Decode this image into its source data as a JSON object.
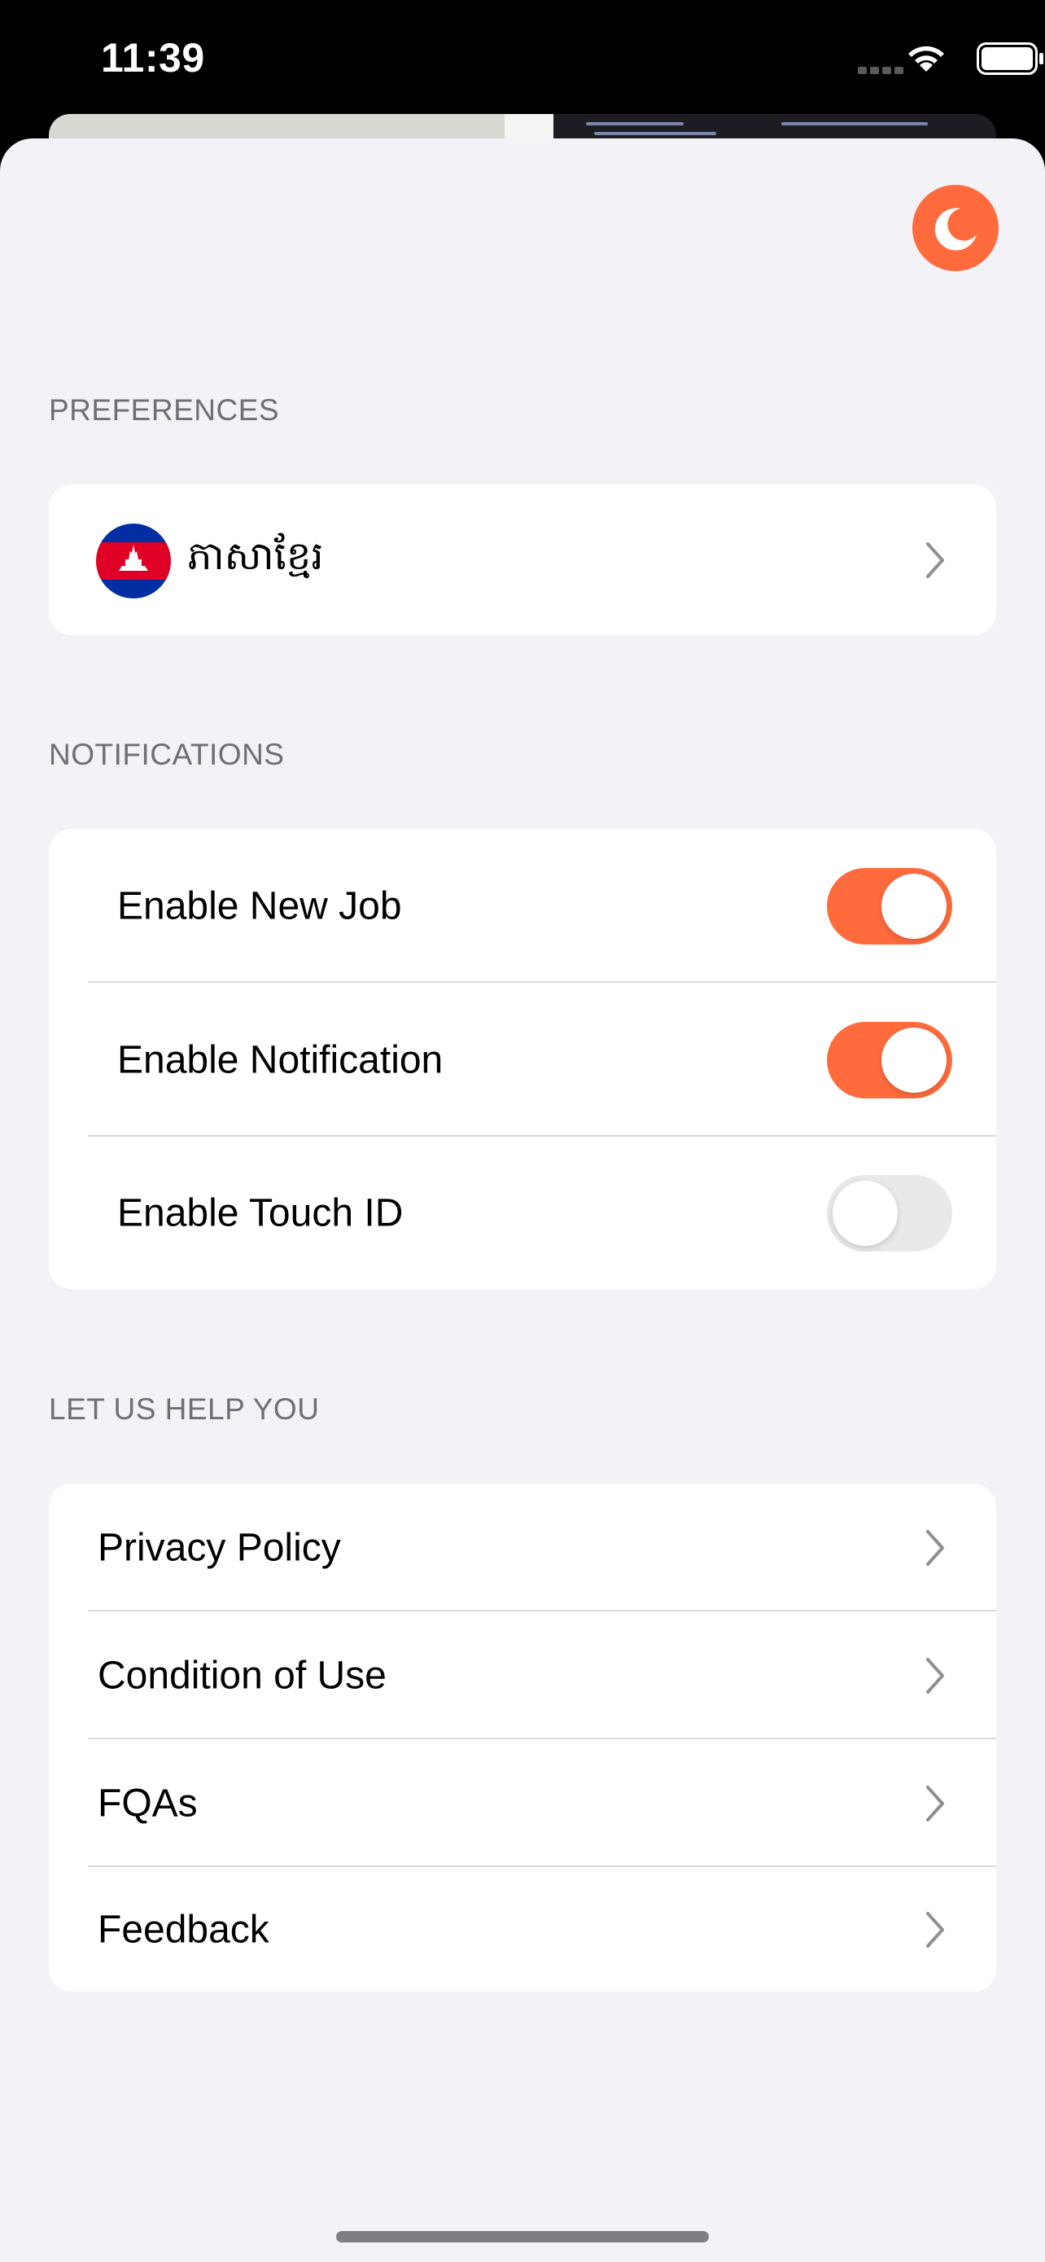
{
  "status_bar": {
    "time": "11:39"
  },
  "theme": {
    "accent": "#ff6b3d",
    "icon": "moon-icon"
  },
  "preferences": {
    "header": "PREFERENCES",
    "language_label": "ភាសាខ្មែរ",
    "flag_icon": "cambodia-flag-icon"
  },
  "notifications": {
    "header": "NOTIFICATIONS",
    "items": [
      {
        "label": "Enable New Job",
        "enabled": true
      },
      {
        "label": "Enable Notification",
        "enabled": true
      },
      {
        "label": "Enable Touch ID",
        "enabled": false
      }
    ]
  },
  "help": {
    "header": "LET US HELP YOU",
    "items": [
      {
        "label": "Privacy Policy"
      },
      {
        "label": "Condition of Use"
      },
      {
        "label": "FQAs"
      },
      {
        "label": "Feedback"
      }
    ]
  }
}
